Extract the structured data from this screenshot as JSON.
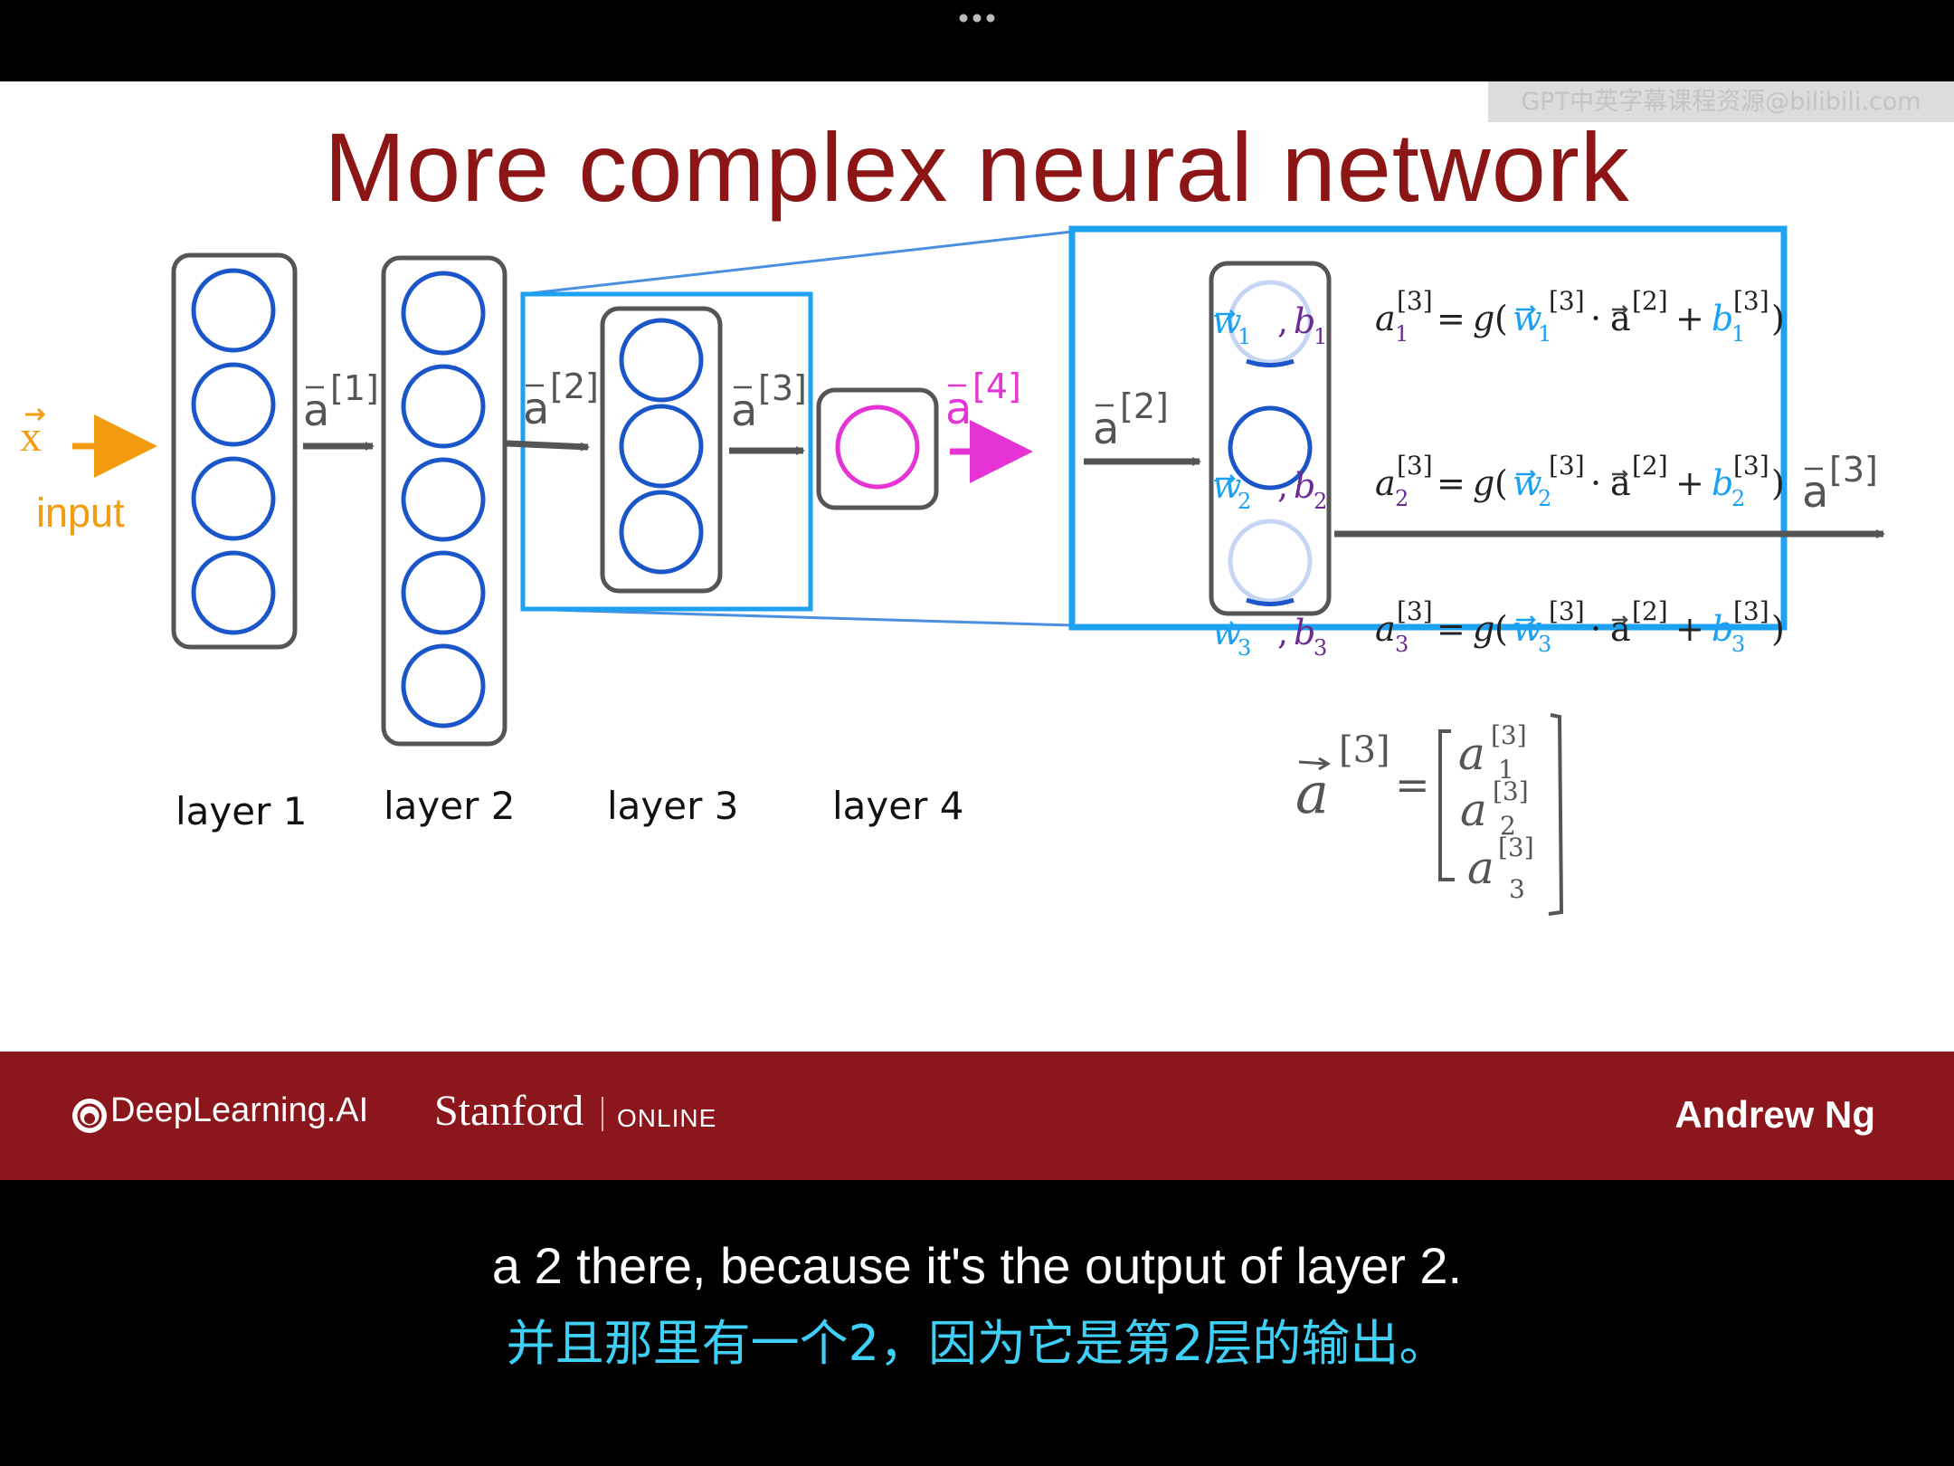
{
  "topbar": {
    "menu_icon": "more-dots-icon"
  },
  "watermark": "GPT中英字幕课程资源@bilibili.com",
  "slide": {
    "title": "More complex neural network",
    "input_label": "input",
    "x_label": "x",
    "layers": [
      {
        "label": "layer 1",
        "units": 4
      },
      {
        "label": "layer 2",
        "units": 5
      },
      {
        "label": "layer 3",
        "units": 3
      },
      {
        "label": "layer 4",
        "units": 1
      }
    ],
    "activations": [
      {
        "base": "a",
        "sup": "[1]"
      },
      {
        "base": "a",
        "sup": "[2]"
      },
      {
        "base": "a",
        "sup": "[3]"
      },
      {
        "base": "a",
        "sup": "[4]"
      }
    ],
    "zoom": {
      "input": {
        "base": "a",
        "sup": "[2]"
      },
      "output": {
        "base": "a",
        "sup": "[3]"
      },
      "units": [
        {
          "w": "w",
          "b": "b",
          "sub": "1"
        },
        {
          "w": "w",
          "b": "b",
          "sub": "2"
        },
        {
          "w": "w",
          "b": "b",
          "sub": "3"
        }
      ],
      "equations": [
        {
          "lhs": "a",
          "sub": "1",
          "layer": "[3]",
          "prev": "[2]"
        },
        {
          "lhs": "a",
          "sub": "2",
          "layer": "[3]",
          "prev": "[2]"
        },
        {
          "lhs": "a",
          "sub": "3",
          "layer": "[3]",
          "prev": "[2]"
        }
      ],
      "g": "g"
    },
    "handwritten": {
      "vector": "a",
      "sup": "[3]",
      "entries": [
        "1",
        "2",
        "3"
      ]
    }
  },
  "footer": {
    "brand": "DeepLearning.AI",
    "stanford": "Stanford",
    "online": "ONLINE",
    "author": "Andrew Ng"
  },
  "subtitles": {
    "en": "a 2 there, because it's the output of layer 2.",
    "zh": "并且那里有一个2，因为它是第2层的输出。"
  },
  "colors": {
    "title": "#8c1515",
    "node_blue": "#1a56c9",
    "zoom_box": "#1da1f2",
    "output_magenta": "#e633d4",
    "input_orange": "#f39c12",
    "param_purple": "#6a2c91",
    "footer": "#8b161b",
    "subtitle_zh": "#3fd0f7"
  }
}
